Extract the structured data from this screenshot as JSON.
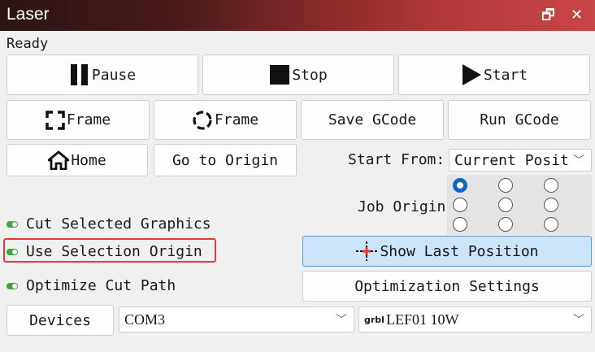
{
  "window": {
    "title": "Laser"
  },
  "status": "Ready",
  "buttons": {
    "pause": "Pause",
    "stop": "Stop",
    "start": "Start",
    "frame_rect": "Frame",
    "frame_circle": "Frame",
    "save_gcode": "Save GCode",
    "run_gcode": "Run GCode",
    "home": "Home",
    "go_to_origin": "Go to Origin",
    "show_last_position": "Show Last Position",
    "optimization_settings": "Optimization Settings",
    "devices": "Devices"
  },
  "start_from": {
    "label": "Start From:",
    "value": "Current Posit"
  },
  "job_origin": {
    "label": "Job Origin",
    "selected_index": 0
  },
  "options": {
    "cut_selected_graphics": "Cut Selected Graphics",
    "use_selection_origin": "Use Selection Origin",
    "optimize_cut_path": "Optimize Cut Path"
  },
  "port": {
    "value": "COM3"
  },
  "device": {
    "prefix": "grbl",
    "value": "LEF01 10W"
  },
  "colors": {
    "highlight": "#e53935",
    "toggle_on": "#3ca53c",
    "radio_selected": "#1565c0"
  }
}
